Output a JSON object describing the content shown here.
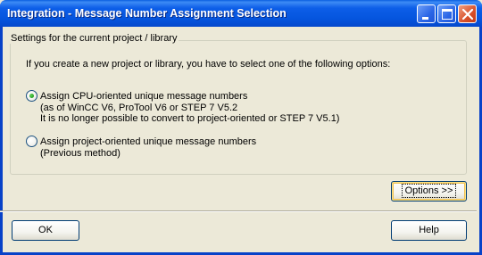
{
  "window": {
    "title": "Integration - Message Number Assignment Selection"
  },
  "group": {
    "legend": "Settings for the current project / library",
    "intro": "If you create a new project or library, you have to select one of the following options:"
  },
  "options": [
    {
      "selected": true,
      "lines": [
        "Assign CPU-oriented unique message numbers",
        "(as of WinCC V6, ProTool V6 or STEP 7 V5.2",
        "It is no longer possible to convert to project-oriented or STEP 7 V5.1)"
      ]
    },
    {
      "selected": false,
      "lines": [
        "Assign project-oriented unique message numbers",
        "(Previous method)"
      ]
    }
  ],
  "buttons": {
    "options": "Options >>",
    "ok": "OK",
    "help": "Help"
  },
  "colors": {
    "titlebar": "#0555de",
    "face": "#ece9d8",
    "close_button": "#d7502a"
  }
}
